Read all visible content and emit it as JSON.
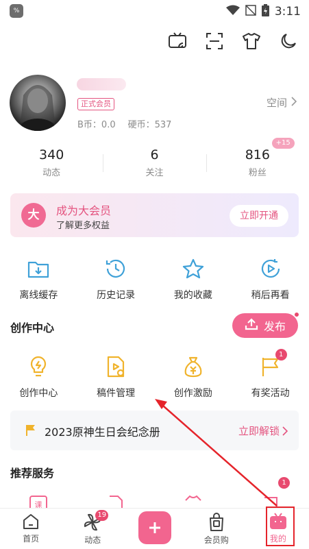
{
  "status_bar": {
    "time": "3:11",
    "app_icon_text": "%"
  },
  "top_icons": [
    "tv-cast-icon",
    "scan-icon",
    "shirt-icon",
    "moon-icon"
  ],
  "profile": {
    "vip_badge": "正式会员",
    "b_coin_label": "B币：0.0",
    "hard_coin_label": "硬币：537",
    "space_label": "空间"
  },
  "stats": [
    {
      "value": "340",
      "label": "动态"
    },
    {
      "value": "6",
      "label": "关注"
    },
    {
      "value": "816",
      "label": "粉丝",
      "badge": "+15"
    }
  ],
  "vip_card": {
    "icon_text": "大",
    "title": "成为大会员",
    "subtitle": "了解更多权益",
    "button": "立即开通"
  },
  "quick_actions": [
    {
      "label": "离线缓存",
      "icon": "download-folder-icon"
    },
    {
      "label": "历史记录",
      "icon": "history-clock-icon"
    },
    {
      "label": "我的收藏",
      "icon": "star-icon"
    },
    {
      "label": "稍后再看",
      "icon": "watch-later-icon"
    }
  ],
  "creation": {
    "title": "创作中心",
    "publish_label": "发布",
    "items": [
      {
        "label": "创作中心",
        "icon": "bulb-icon"
      },
      {
        "label": "稿件管理",
        "icon": "manuscript-icon"
      },
      {
        "label": "创作激励",
        "icon": "money-bag-icon"
      },
      {
        "label": "有奖活动",
        "icon": "flag-icon",
        "badge": "1"
      }
    ]
  },
  "banner": {
    "text": "2023原神生日会纪念册",
    "action": "立即解锁"
  },
  "recommend": {
    "title": "推荐服务",
    "first_icon_text": "课",
    "badge": "1"
  },
  "tabbar": {
    "items": [
      {
        "label": "首页",
        "icon": "home-icon"
      },
      {
        "label": "动态",
        "icon": "pinwheel-icon",
        "badge": "19"
      },
      {
        "label": "",
        "icon": "plus-icon"
      },
      {
        "label": "会员购",
        "icon": "shopping-bag-icon"
      },
      {
        "label": "我的",
        "icon": "tv-mascot-icon",
        "active": true
      }
    ]
  },
  "colors": {
    "accent": "#f2658f",
    "annotation": "#e5242b",
    "icon_blue": "#3fa1d8",
    "icon_yellow": "#f0b32c"
  }
}
